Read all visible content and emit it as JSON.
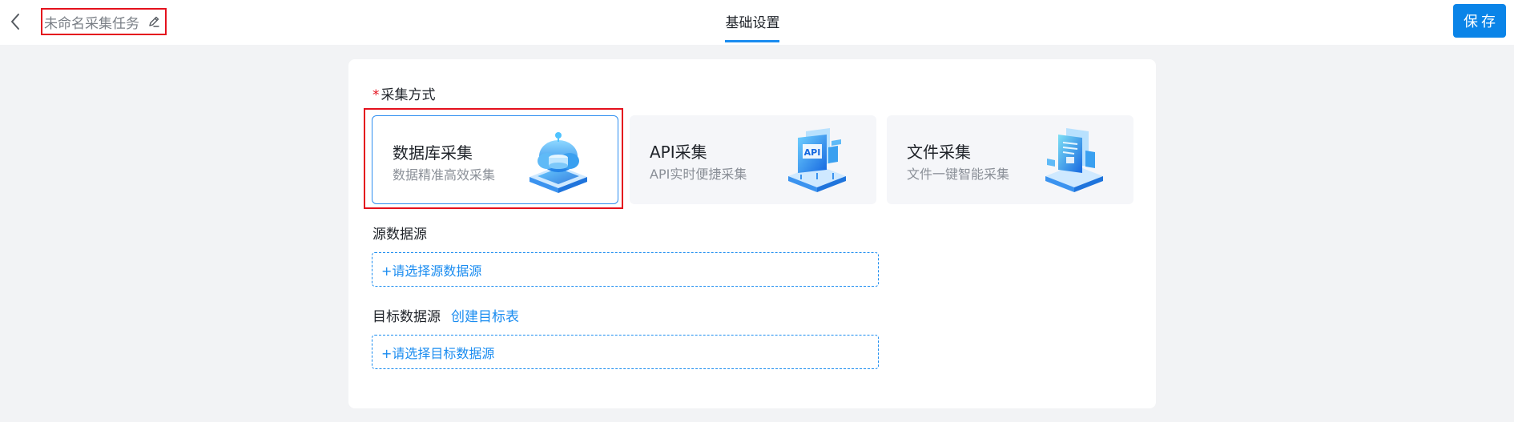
{
  "header": {
    "back_icon": "chevron-left-icon",
    "task_name": "未命名采集任务",
    "edit_icon": "pencil-icon",
    "tab_label": "基础设置",
    "save_label": "保存"
  },
  "collection_method": {
    "label": "采集方式",
    "required_mark": "*",
    "options": [
      {
        "title": "数据库采集",
        "subtitle": "数据精准高效采集",
        "icon": "database-cloud-icon",
        "selected": true
      },
      {
        "title": "API采集",
        "subtitle": "API实时便捷采集",
        "icon": "api-icon",
        "selected": false
      },
      {
        "title": "文件采集",
        "subtitle": "文件一键智能采集",
        "icon": "file-icon",
        "selected": false
      }
    ]
  },
  "source": {
    "label": "源数据源",
    "placeholder": "+请选择源数据源"
  },
  "target": {
    "label": "目标数据源",
    "create_link": "创建目标表",
    "placeholder": "+请选择目标数据源"
  },
  "colors": {
    "accent": "#1a8cf0",
    "save_button": "#0a84e8",
    "required": "#e4111d",
    "background": "#f2f3f5"
  }
}
